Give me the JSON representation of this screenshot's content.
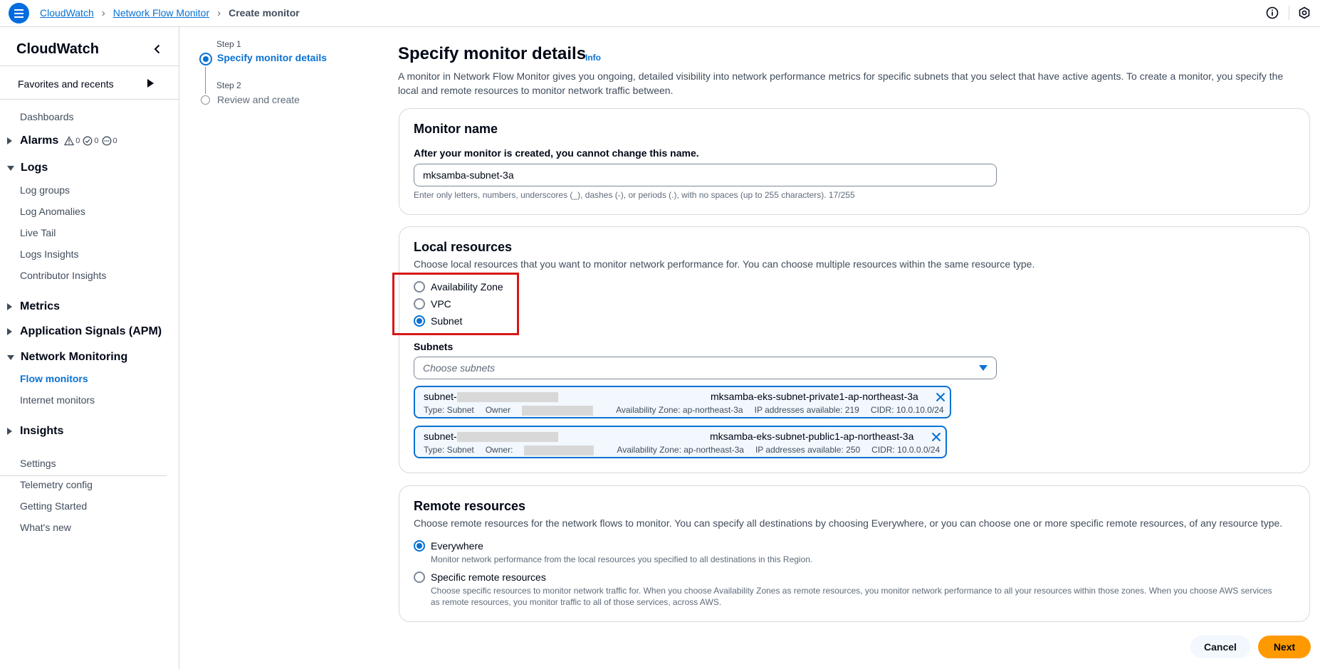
{
  "topbar": {
    "breadcrumbs": [
      "CloudWatch",
      "Network Flow Monitor",
      "Create monitor"
    ]
  },
  "sidebar": {
    "title": "CloudWatch",
    "favorites": "Favorites and recents",
    "dashboards": "Dashboards",
    "alarms": {
      "label": "Alarms",
      "alarm_count": "0",
      "ok_count": "0",
      "insufficient_count": "0"
    },
    "logs": {
      "label": "Logs",
      "items": [
        "Log groups",
        "Log Anomalies",
        "Live Tail",
        "Logs Insights",
        "Contributor Insights"
      ]
    },
    "metrics": "Metrics",
    "app_signals": "Application Signals (APM)",
    "network_monitoring": {
      "label": "Network Monitoring",
      "items": [
        "Flow monitors",
        "Internet monitors"
      ],
      "active_item": "Flow monitors"
    },
    "insights": "Insights",
    "footer_items": [
      "Settings",
      "Telemetry config",
      "Getting Started",
      "What's new"
    ]
  },
  "steps": [
    {
      "step": "Step 1",
      "title": "Specify monitor details",
      "state": "active"
    },
    {
      "step": "Step 2",
      "title": "Review and create",
      "state": "pending"
    }
  ],
  "main": {
    "title": "Specify monitor details",
    "info": "Info",
    "description": "A monitor in Network Flow Monitor gives you ongoing, detailed visibility into network performance metrics for specific subnets that you select that have active agents. To create a monitor, you specify the local and remote resources to monitor network traffic between."
  },
  "monitor_name": {
    "heading": "Monitor name",
    "label": "After your monitor is created, you cannot change this name.",
    "value": "mksamba-subnet-3a",
    "hint": "Enter only letters, numbers, underscores (_), dashes (-), or periods (.), with no spaces (up to 255 characters). 17/255"
  },
  "local_resources": {
    "heading": "Local resources",
    "description": "Choose local resources that you want to monitor network performance for. You can choose multiple resources within the same resource type.",
    "options": [
      "Availability Zone",
      "VPC",
      "Subnet"
    ],
    "selected": "Subnet",
    "subnets_label": "Subnets",
    "subnets_placeholder": "Choose subnets",
    "tokens": [
      {
        "id": "subnet-",
        "name": "mksamba-eks-subnet-private1-ap-northeast-3a",
        "type": "Type: Subnet",
        "owner": "Owner",
        "az": "Availability Zone: ap-northeast-3a",
        "ips": "IP addresses available: 219",
        "cidr": "CIDR: 10.0.10.0/24"
      },
      {
        "id": "subnet-",
        "name": "mksamba-eks-subnet-public1-ap-northeast-3a",
        "type": "Type: Subnet",
        "owner": "Owner:",
        "az": "Availability Zone: ap-northeast-3a",
        "ips": "IP addresses available: 250",
        "cidr": "CIDR: 10.0.0.0/24"
      }
    ]
  },
  "remote_resources": {
    "heading": "Remote resources",
    "description": "Choose remote resources for the network flows to monitor. You can specify all destinations by choosing Everywhere, or you can choose one or more specific remote resources, of any resource type.",
    "options": [
      {
        "label": "Everywhere",
        "sub": "Monitor network performance from the local resources you specified to all destinations in this Region."
      },
      {
        "label": "Specific remote resources",
        "sub": "Choose specific resources to monitor network traffic for. When you choose Availability Zones as remote resources, you monitor network performance to all your resources within those zones. When you choose AWS services as remote resources, you monitor traffic to all of those services, across AWS."
      }
    ],
    "selected": "Everywhere"
  },
  "actions": {
    "cancel": "Cancel",
    "next": "Next"
  },
  "colors": {
    "accent": "#0972d3",
    "primary_button": "#ff9900",
    "highlight": "#d91515"
  }
}
